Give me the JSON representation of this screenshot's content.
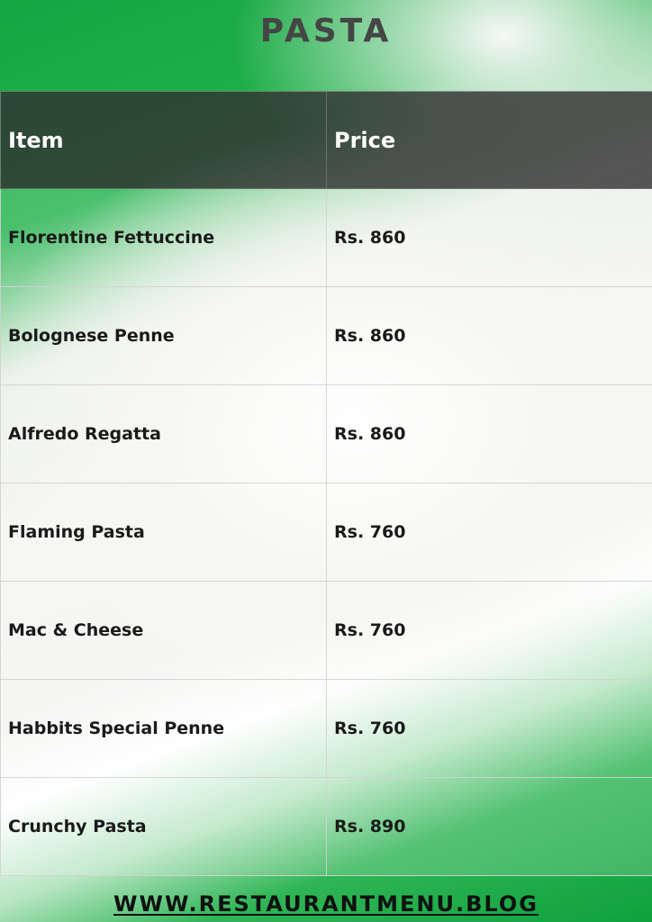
{
  "title": "PASTA",
  "table": {
    "headers": [
      "Item",
      "Price"
    ],
    "rows": [
      {
        "item": "Florentine Fettuccine",
        "price": "Rs. 860"
      },
      {
        "item": "Bolognese Penne",
        "price": "Rs. 860"
      },
      {
        "item": "Alfredo Regatta",
        "price": "Rs. 860"
      },
      {
        "item": "Flaming Pasta",
        "price": "Rs. 760"
      },
      {
        "item": "Mac & Cheese",
        "price": "Rs. 760"
      },
      {
        "item": "Habbits Special Penne",
        "price": "Rs. 760"
      },
      {
        "item": "Crunchy Pasta",
        "price": "Rs. 890"
      }
    ]
  },
  "footer": {
    "url": "WWW.RESTAURANTMENU.BLOG"
  },
  "colors": {
    "accent_green": "#1aa947",
    "header_dark": "#3a3a3a",
    "title_gray": "#454545"
  }
}
